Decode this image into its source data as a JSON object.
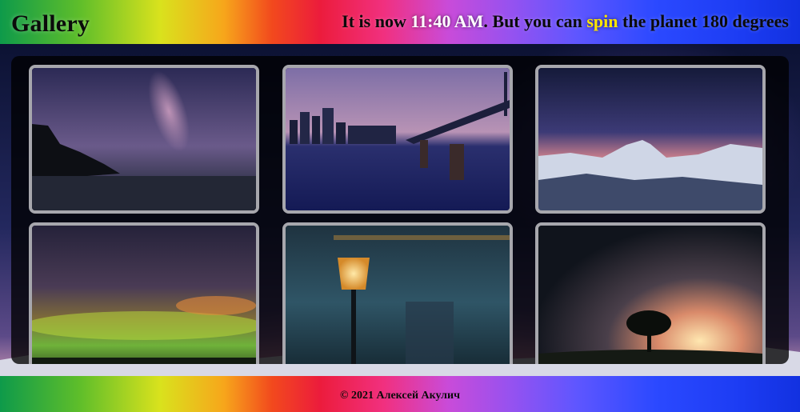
{
  "header": {
    "logo": "Gallery",
    "headline_prefix": "It is now ",
    "time": "11:40 AM",
    "headline_middle": ". But you can ",
    "spin_link": "spin",
    "headline_suffix": " the planet 180 degrees"
  },
  "gallery": {
    "images": [
      {
        "subject": "milky-way-over-coast"
      },
      {
        "subject": "night-bridge-city-skyline"
      },
      {
        "subject": "matterhorn-under-stars"
      },
      {
        "subject": "aurora-over-lake"
      },
      {
        "subject": "street-lamp-at-night"
      },
      {
        "subject": "lone-tree-under-starry-sky"
      }
    ]
  },
  "footer": {
    "copyright": "© 2021 Алексей Акулич"
  },
  "colors": {
    "time": "#ffffff",
    "spin": "#ffe500",
    "thumb_border": "#a7a7ad",
    "panel_background": "rgba(0,0,0,0.78)"
  }
}
